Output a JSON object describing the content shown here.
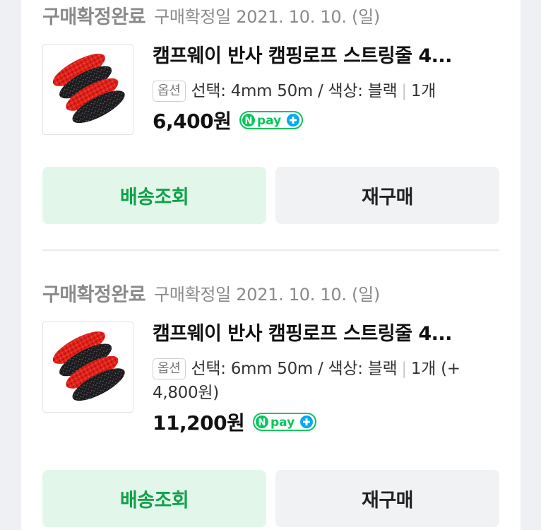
{
  "colors": {
    "accent_green": "#10a14a",
    "ship_button_bg": "#e2f7ea",
    "rebuy_button_bg": "#f1f2f4",
    "status_gray": "#8a8a8a"
  },
  "orders": [
    {
      "status": "구매확정완료",
      "confirm_date": "구매확정일 2021. 10. 10. (일)",
      "product_name": "캠프웨이 반사 캠핑로프 스트링줄 4...",
      "option_badge": "옵션",
      "option_text": "선택: 4mm 50m / 색상: 블랙",
      "quantity": "1개",
      "extra_price": "",
      "price": "6,400원",
      "npay_label": "Npay+",
      "ship_button": "배송조회",
      "rebuy_button": "재구매",
      "thumbnail_icon": "rope-product-image"
    },
    {
      "status": "구매확정완료",
      "confirm_date": "구매확정일 2021. 10. 10. (일)",
      "product_name": "캠프웨이 반사 캠핑로프 스트링줄 4...",
      "option_badge": "옵션",
      "option_text": "선택: 6mm 50m / 색상: 블랙",
      "quantity": "1개",
      "extra_price": "(+ 4,800원)",
      "price": "11,200원",
      "npay_label": "Npay+",
      "ship_button": "배송조회",
      "rebuy_button": "재구매",
      "thumbnail_icon": "rope-product-image"
    }
  ]
}
